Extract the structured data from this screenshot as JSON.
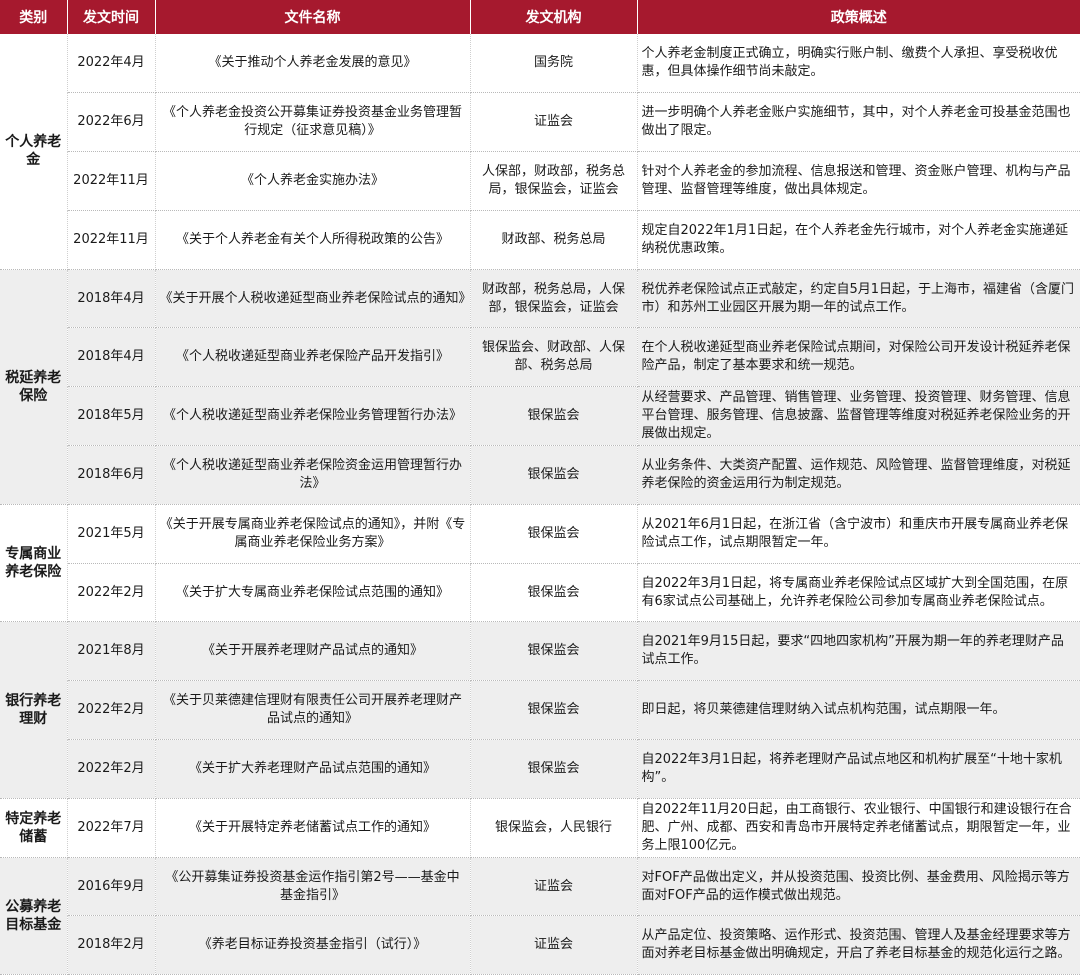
{
  "header": {
    "category": "类别",
    "date": "发文时间",
    "title": "文件名称",
    "issuer": "发文机构",
    "summary": "政策概述"
  },
  "groups": [
    {
      "category": "个人养老金",
      "rows": [
        {
          "date": "2022年4月",
          "title": "《关于推动个人养老金发展的意见》",
          "issuer": "国务院",
          "summary": "个人养老金制度正式确立，明确实行账户制、缴费个人承担、享受税收优惠，但具体操作细节尚未敲定。"
        },
        {
          "date": "2022年6月",
          "title": "《个人养老金投资公开募集证券投资基金业务管理暂行规定（征求意见稿）》",
          "issuer": "证监会",
          "summary": "进一步明确个人养老金账户实施细节，其中，对个人养老金可投基金范围也做出了限定。"
        },
        {
          "date": "2022年11月",
          "title": "《个人养老金实施办法》",
          "issuer": "人保部，财政部，税务总局，银保监会，证监会",
          "summary": "针对个人养老金的参加流程、信息报送和管理、资金账户管理、机构与产品管理、监督管理等维度，做出具体规定。"
        },
        {
          "date": "2022年11月",
          "title": "《关于个人养老金有关个人所得税政策的公告》",
          "issuer": "财政部、税务总局",
          "summary": "规定自2022年1月1日起，在个人养老金先行城市，对个人养老金实施递延纳税优惠政策。"
        }
      ]
    },
    {
      "category": "税延养老保险",
      "rows": [
        {
          "date": "2018年4月",
          "title": "《关于开展个人税收递延型商业养老保险试点的通知》",
          "issuer": "财政部，税务总局，人保部，银保监会，证监会",
          "summary": "税优养老保险试点正式敲定，约定自5月1日起，于上海市，福建省（含厦门市）和苏州工业园区开展为期一年的试点工作。"
        },
        {
          "date": "2018年4月",
          "title": "《个人税收递延型商业养老保险产品开发指引》",
          "issuer": "银保监会、财政部、人保部、税务总局",
          "summary": "在个人税收递延型商业养老保险试点期间，对保险公司开发设计税延养老保险产品，制定了基本要求和统一规范。"
        },
        {
          "date": "2018年5月",
          "title": "《个人税收递延型商业养老保险业务管理暂行办法》",
          "issuer": "银保监会",
          "summary": "从经营要求、产品管理、销售管理、业务管理、投资管理、财务管理、信息平台管理、服务管理、信息披露、监督管理等维度对税延养老保险业务的开展做出规定。"
        },
        {
          "date": "2018年6月",
          "title": "《个人税收递延型商业养老保险资金运用管理暂行办法》",
          "issuer": "银保监会",
          "summary": "从业务条件、大类资产配置、运作规范、风险管理、监督管理维度，对税延养老保险的资金运用行为制定规范。"
        }
      ]
    },
    {
      "category": "专属商业养老保险",
      "rows": [
        {
          "date": "2021年5月",
          "title": "《关于开展专属商业养老保险试点的通知》，并附《专属商业养老保险业务方案》",
          "issuer": "银保监会",
          "summary": "从2021年6月1日起，在浙江省（含宁波市）和重庆市开展专属商业养老保险试点工作，试点期限暂定一年。"
        },
        {
          "date": "2022年2月",
          "title": "《关于扩大专属商业养老保险试点范围的通知》",
          "issuer": "银保监会",
          "summary": "自2022年3月1日起，将专属商业养老保险试点区域扩大到全国范围，在原有6家试点公司基础上，允许养老保险公司参加专属商业养老保险试点。"
        }
      ]
    },
    {
      "category": "银行养老理财",
      "rows": [
        {
          "date": "2021年8月",
          "title": "《关于开展养老理财产品试点的通知》",
          "issuer": "银保监会",
          "summary": "自2021年9月15日起，要求“四地四家机构”开展为期一年的养老理财产品试点工作。"
        },
        {
          "date": "2022年2月",
          "title": "《关于贝莱德建信理财有限责任公司开展养老理财产品试点的通知》",
          "issuer": "银保监会",
          "summary": "即日起，将贝莱德建信理财纳入试点机构范围，试点期限一年。"
        },
        {
          "date": "2022年2月",
          "title": "《关于扩大养老理财产品试点范围的通知》",
          "issuer": "银保监会",
          "summary": "自2022年3月1日起，将养老理财产品试点地区和机构扩展至“十地十家机构”。"
        }
      ]
    },
    {
      "category": "特定养老储蓄",
      "rows": [
        {
          "date": "2022年7月",
          "title": "《关于开展特定养老储蓄试点工作的通知》",
          "issuer": "银保监会，人民银行",
          "summary": "自2022年11月20日起，由工商银行、农业银行、中国银行和建设银行在合肥、广州、成都、西安和青岛市开展特定养老储蓄试点，期限暂定一年，业务上限100亿元。"
        }
      ]
    },
    {
      "category": "公募养老目标基金",
      "rows": [
        {
          "date": "2016年9月",
          "title": "《公开募集证券投资基金运作指引第2号——基金中基金指引》",
          "issuer": "证监会",
          "summary": "对FOF产品做出定义，并从投资范围、投资比例、基金费用、风险揭示等方面对FOF产品的运作模式做出规范。"
        },
        {
          "date": "2018年2月",
          "title": "《养老目标证券投资基金指引（试行）》",
          "issuer": "证监会",
          "summary": "从产品定位、投资策略、运作形式、投资范围、管理人及基金经理要求等方面对养老目标基金做出明确规定，开启了养老目标基金的规范化运行之路。"
        }
      ]
    }
  ],
  "colors": {
    "header_bg": "#a6192e",
    "header_text": "#ffffff",
    "shade_bg": "#eeeeee"
  }
}
